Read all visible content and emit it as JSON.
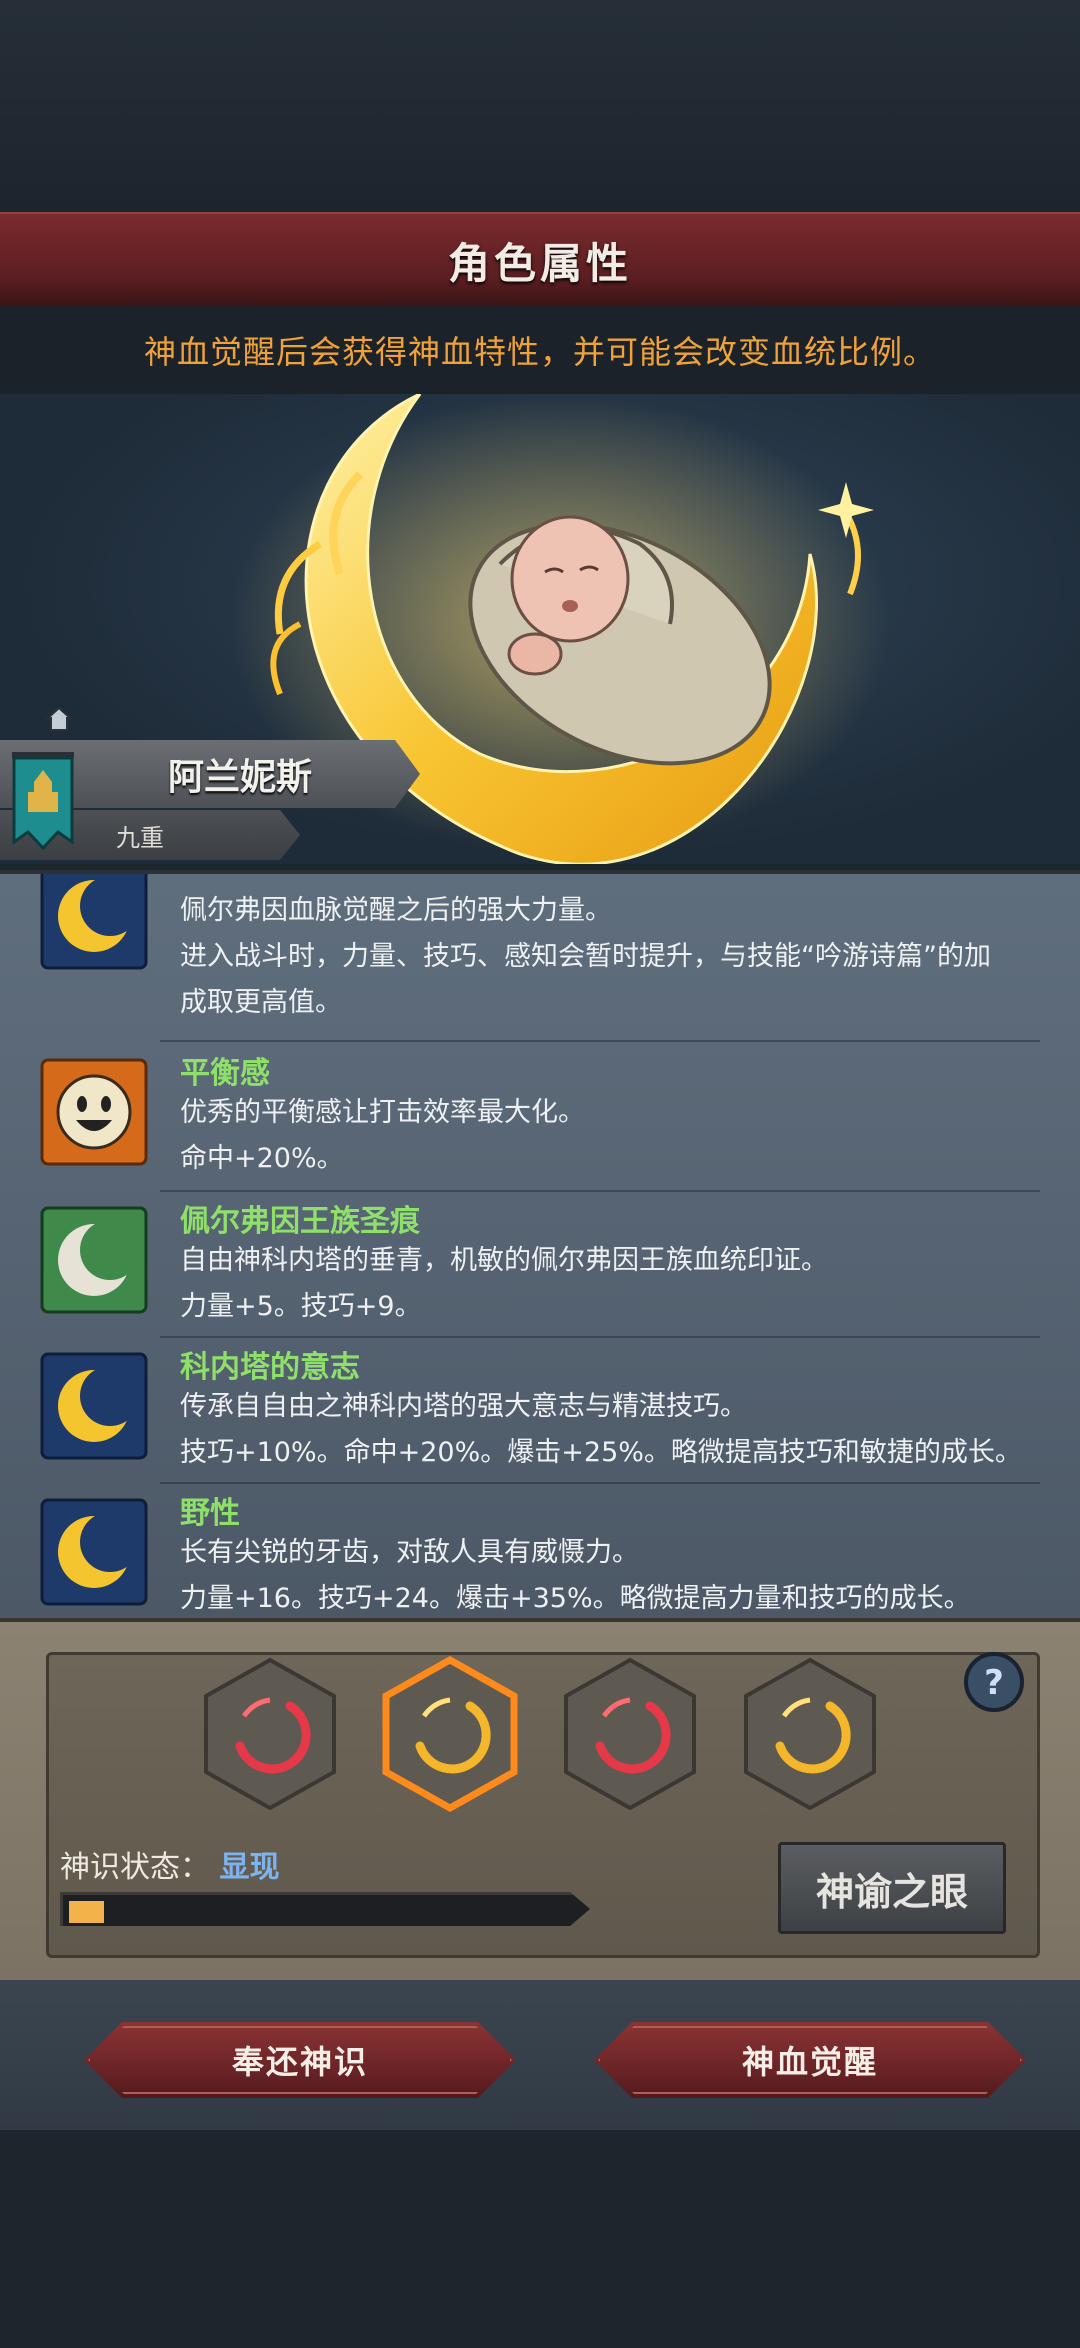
{
  "header": {
    "title": "角色属性",
    "subtitle": "神血觉醒后会获得神血特性，并可能会改变血统比例。"
  },
  "character": {
    "name": "阿兰妮斯",
    "rank": "九重"
  },
  "traits": [
    {
      "name": "",
      "icon": "crescent-moon-icon",
      "line1": "佩尔弗因血脉觉醒之后的强大力量。",
      "line2": "进入战斗时，力量、技巧、感知会暂时提升，与技能“吟游诗篇”的加",
      "line3": "成取更高值。"
    },
    {
      "name": "平衡感",
      "icon": "smiley-face-icon",
      "line1": "优秀的平衡感让打击效率最大化。",
      "line2": "命中+20%。"
    },
    {
      "name": "佩尔弗因王族圣痕",
      "icon": "pale-crescent-icon",
      "line1": "自由神科内塔的垂青，机敏的佩尔弗因王族血统印证。",
      "line2": "力量+5。技巧+9。"
    },
    {
      "name": "科内塔的意志",
      "icon": "crescent-moon-icon",
      "line1": "传承自自由之神科内塔的强大意志与精湛技巧。",
      "line2": "技巧+10%。命中+20%。爆击+25%。略微提高技巧和敏捷的成长。"
    },
    {
      "name": "野性",
      "icon": "crescent-moon-icon",
      "line1": "长有尖锐的牙齿，对敌人具有威慑力。",
      "line2": "力量+16。技巧+24。爆击+35%。略微提高力量和技巧的成长。"
    }
  ],
  "awakening": {
    "status_label": "神识状态：",
    "status_value": "显现",
    "progress": 0.07,
    "oracle_button": "神谕之眼",
    "slots": [
      "red",
      "gold-selected",
      "red",
      "gold"
    ]
  },
  "buttons": {
    "return": "奉还神识",
    "awaken": "神血觉醒"
  },
  "colors": {
    "trait_name": "#8fe06a",
    "subtitle": "#f0a23a",
    "status_value": "#7db3f0",
    "progress_fill": "#f4b34a"
  }
}
